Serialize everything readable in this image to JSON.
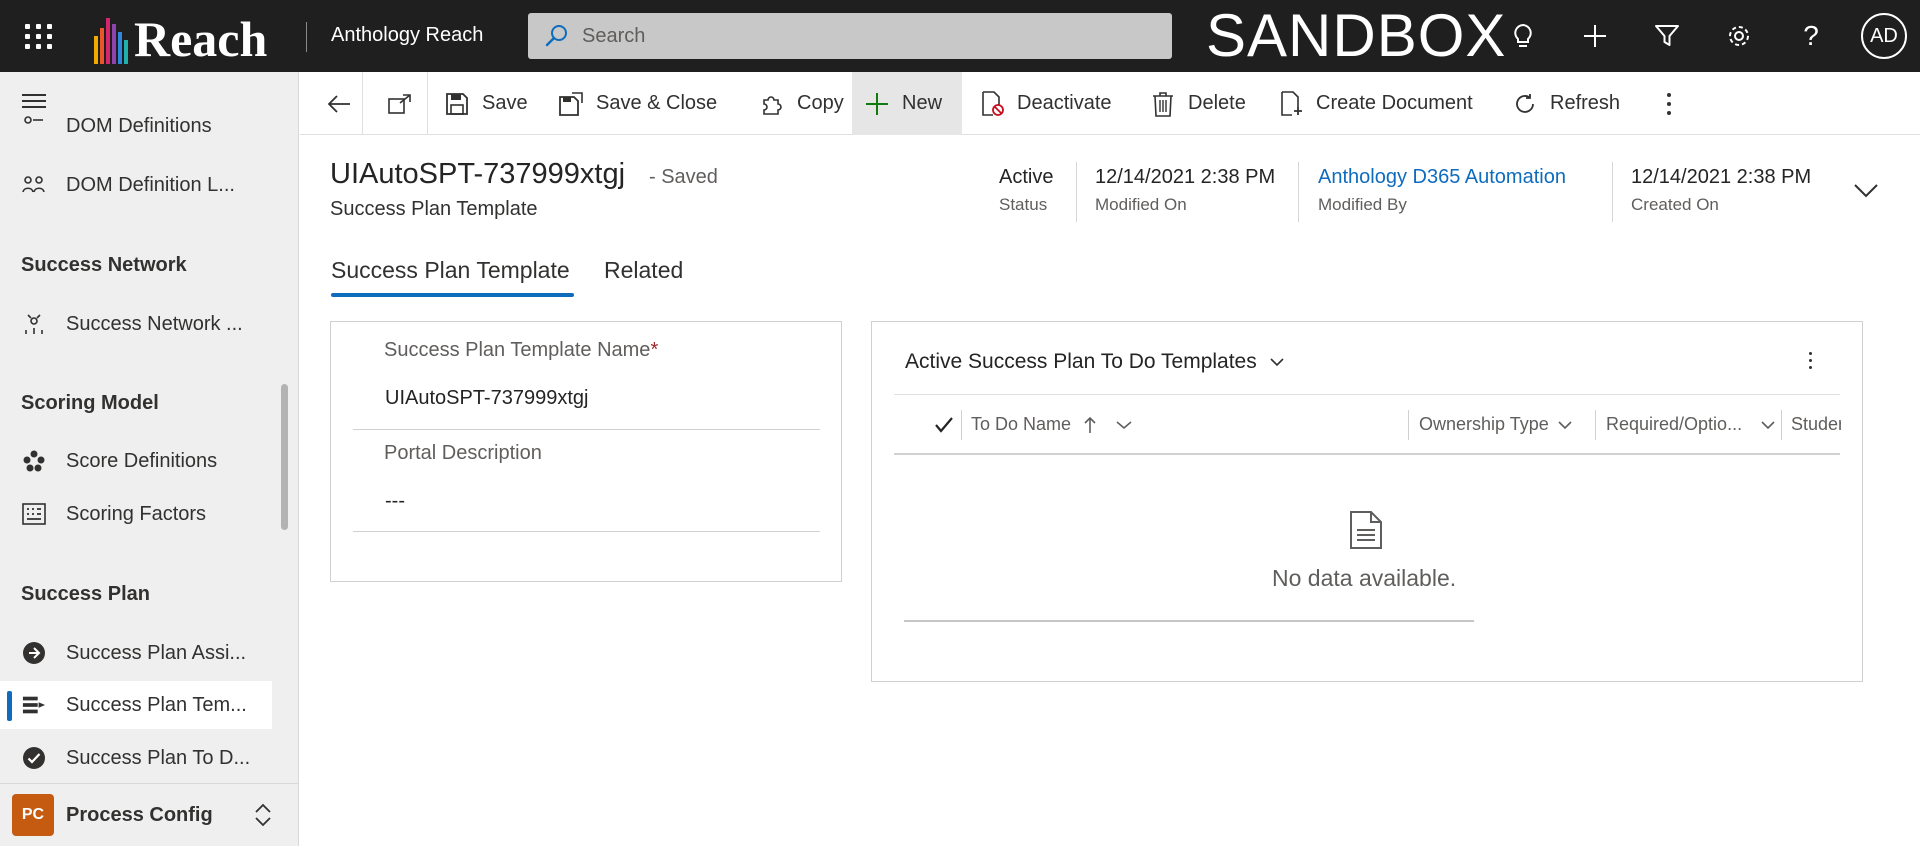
{
  "topbar": {
    "logo_text": "Reach",
    "app_name": "Anthology Reach",
    "search_placeholder": "Search",
    "environment_label": "SANDBOX",
    "avatar_initials": "AD",
    "icons": [
      "waffle-icon",
      "lightbulb-icon",
      "plus-icon",
      "filter-icon",
      "gear-icon",
      "help-icon"
    ]
  },
  "sidebar": {
    "items": [
      {
        "label": "DOM Definitions",
        "icon": "dom-definitions-icon"
      },
      {
        "label": "DOM Definition L...",
        "icon": "dom-definition-link-icon"
      },
      {
        "label": "Success Network ...",
        "icon": "success-network-icon"
      },
      {
        "label": "Score Definitions",
        "icon": "score-definitions-icon"
      },
      {
        "label": "Scoring Factors",
        "icon": "scoring-factors-icon"
      },
      {
        "label": "Success Plan Assi...",
        "icon": "arrow-circle-icon"
      },
      {
        "label": "Success Plan Tem...",
        "icon": "template-icon"
      },
      {
        "label": "Success Plan To D...",
        "icon": "check-circle-icon"
      }
    ],
    "groups": {
      "success_network": "Success Network",
      "scoring_model": "Scoring Model",
      "success_plan": "Success Plan"
    },
    "area": {
      "badge": "PC",
      "label": "Process Config"
    }
  },
  "commands": {
    "save": "Save",
    "save_close": "Save & Close",
    "copy": "Copy",
    "new": "New",
    "deactivate": "Deactivate",
    "delete": "Delete",
    "create_document": "Create Document",
    "refresh": "Refresh"
  },
  "record": {
    "title": "UIAutoSPT-737999xtgj",
    "saved_state": "- Saved",
    "entity": "Success Plan Template",
    "header_fields": [
      {
        "value": "Active",
        "label": "Status"
      },
      {
        "value": "12/14/2021 2:38 PM",
        "label": "Modified On"
      },
      {
        "value": "Anthology D365 Automation",
        "label": "Modified By"
      },
      {
        "value": "12/14/2021 2:38 PM",
        "label": "Created On"
      }
    ]
  },
  "tabs": [
    {
      "label": "Success Plan Template",
      "selected": true
    },
    {
      "label": "Related",
      "selected": false
    }
  ],
  "form": {
    "name_label": "Success Plan Template Name",
    "required_marker": "*",
    "name_value": "UIAutoSPT-737999xtgj",
    "portal_label": "Portal Description",
    "portal_value": "---"
  },
  "subgrid": {
    "title": "Active Success Plan To Do Templates",
    "columns": [
      "To Do Name",
      "Ownership Type",
      "Required/Optio...",
      "Studer"
    ],
    "empty_message": "No data available."
  },
  "colors": {
    "topbar": "#1f1f1f",
    "accent": "#0f6cbd",
    "area_badge": "#c55a11",
    "new_icon": "#107c10"
  }
}
